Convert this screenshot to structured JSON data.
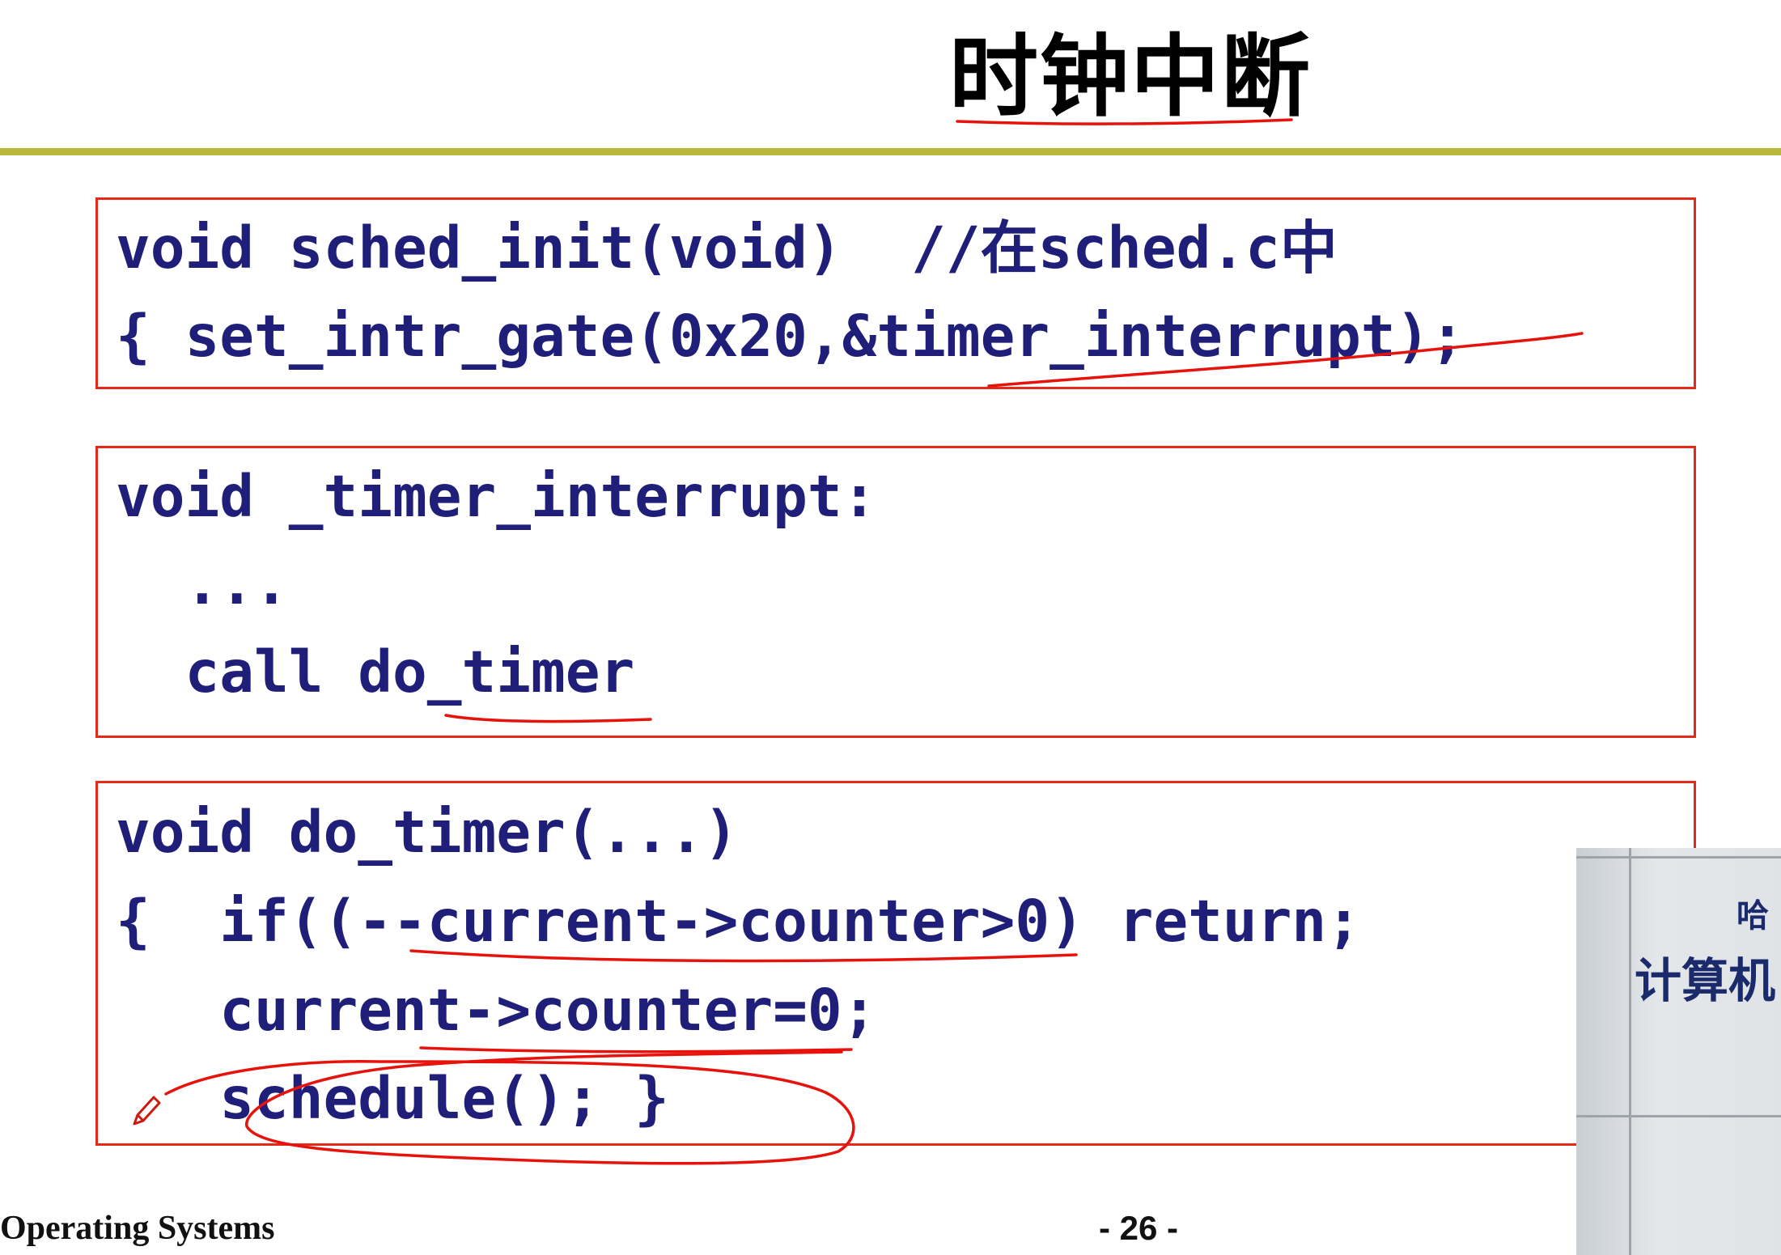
{
  "slide": {
    "title": "时钟中断",
    "footer_left": "Operating Systems",
    "page_number": "- 26 -"
  },
  "code_blocks": [
    {
      "lines": [
        "void sched_init(void)  //在sched.c中",
        "{ set_intr_gate(0x20,&timer_interrupt);"
      ]
    },
    {
      "lines": [
        "void _timer_interrupt:",
        "  ...",
        "  call do_timer"
      ]
    },
    {
      "lines": [
        "void do_timer(...)",
        "{  if((--current->counter>0) return;",
        "   current->counter=0;",
        "   schedule(); }"
      ]
    }
  ],
  "webcam": {
    "sign_line1": "哈",
    "sign_line2": "计算机"
  },
  "colors": {
    "code_text": "#1f1f7a",
    "box_border": "#e52a1c",
    "rule": "#b8b83a",
    "annotation": "#e8120c"
  }
}
